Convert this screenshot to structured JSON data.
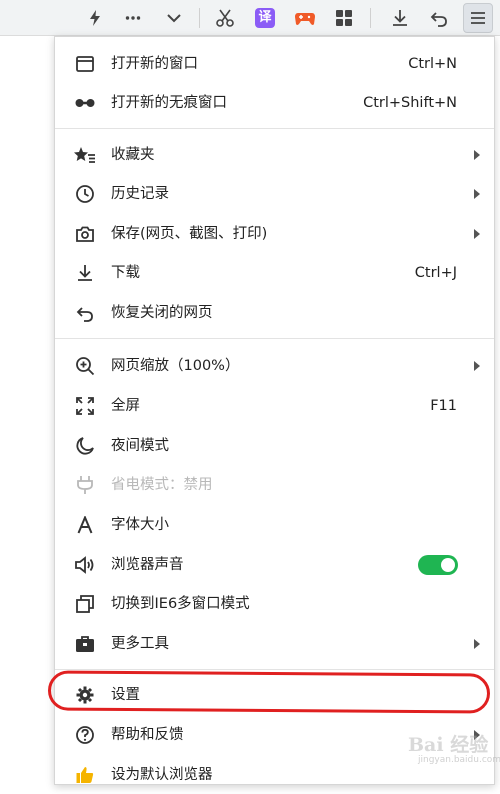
{
  "toolbar": {
    "icons": [
      "lightning-icon",
      "more-icon",
      "chevron-down-icon",
      "scissors-icon",
      "translate-icon",
      "game-icon",
      "apps-grid-icon",
      "download-icon",
      "undo-icon",
      "menu-icon"
    ],
    "translate_glyph": "译"
  },
  "menu": {
    "open_window": {
      "label": "打开新的窗口",
      "shortcut": "Ctrl+N"
    },
    "open_incognito": {
      "label": "打开新的无痕窗口",
      "shortcut": "Ctrl+Shift+N"
    },
    "favorites": {
      "label": "收藏夹"
    },
    "history": {
      "label": "历史记录"
    },
    "save": {
      "label": "保存(网页、截图、打印)"
    },
    "downloads": {
      "label": "下载",
      "shortcut": "Ctrl+J"
    },
    "restore_closed": {
      "label": "恢复关闭的网页"
    },
    "zoom": {
      "label": "网页缩放（100%）"
    },
    "fullscreen": {
      "label": "全屏",
      "shortcut": "F11"
    },
    "night_mode": {
      "label": "夜间模式"
    },
    "power_saving": {
      "label": "省电模式：禁用",
      "enabled": false
    },
    "font_size": {
      "label": "字体大小"
    },
    "browser_sound": {
      "label": "浏览器声音",
      "toggle_on": true
    },
    "ie6_mode": {
      "label": "切换到IE6多窗口模式"
    },
    "more_tools": {
      "label": "更多工具"
    },
    "settings": {
      "label": "设置"
    },
    "help": {
      "label": "帮助和反馈"
    },
    "set_default": {
      "label": "设为默认浏览器"
    }
  },
  "colors": {
    "toggle_on": "#1fb552",
    "highlight": "#e02020",
    "game_icon": "#f05a28",
    "translate_icon": "#8b5cf6",
    "thumb_icon": "#f5b400"
  },
  "watermark": {
    "text": "Bai 经验",
    "sub": "jingyan.baidu.com"
  }
}
